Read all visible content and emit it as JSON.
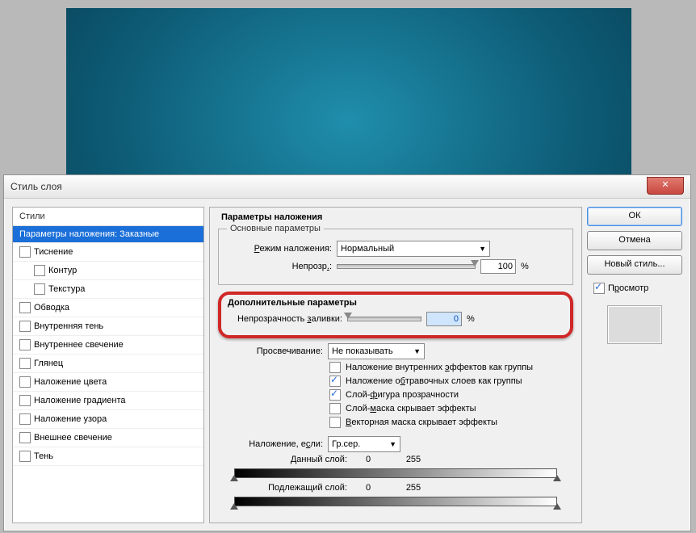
{
  "window_title": "Стиль слоя",
  "sidebar": {
    "header": "Стили",
    "items": [
      {
        "label": "Параметры наложения: Заказные",
        "selected": true,
        "checkbox": false,
        "indent": false
      },
      {
        "label": "Тиснение",
        "selected": false,
        "checkbox": true,
        "indent": false
      },
      {
        "label": "Контур",
        "selected": false,
        "checkbox": true,
        "indent": true
      },
      {
        "label": "Текстура",
        "selected": false,
        "checkbox": true,
        "indent": true
      },
      {
        "label": "Обводка",
        "selected": false,
        "checkbox": true,
        "indent": false
      },
      {
        "label": "Внутренняя тень",
        "selected": false,
        "checkbox": true,
        "indent": false
      },
      {
        "label": "Внутреннее свечение",
        "selected": false,
        "checkbox": true,
        "indent": false
      },
      {
        "label": "Глянец",
        "selected": false,
        "checkbox": true,
        "indent": false
      },
      {
        "label": "Наложение цвета",
        "selected": false,
        "checkbox": true,
        "indent": false
      },
      {
        "label": "Наложение градиента",
        "selected": false,
        "checkbox": true,
        "indent": false
      },
      {
        "label": "Наложение узора",
        "selected": false,
        "checkbox": true,
        "indent": false
      },
      {
        "label": "Внешнее свечение",
        "selected": false,
        "checkbox": true,
        "indent": false
      },
      {
        "label": "Тень",
        "selected": false,
        "checkbox": true,
        "indent": false
      }
    ]
  },
  "buttons": {
    "ok": "ОК",
    "cancel": "Отмена",
    "new_style": "Новый стиль...",
    "preview": "Просмотр"
  },
  "main": {
    "title": "Параметры наложения",
    "basic": {
      "legend": "Основные параметры",
      "blend_mode_label": "Режим наложения:",
      "blend_mode_value": "Нормальный",
      "opacity_label": "Непрозр.:",
      "opacity_value": "100",
      "percent": "%"
    },
    "adv": {
      "legend": "Дополнительные параметры",
      "fill_opacity_label": "Непрозрачность заливки:",
      "fill_opacity_value": "0",
      "percent": "%",
      "knockout_label": "Просвечивание:",
      "knockout_value": "Не показывать",
      "chk1": "Наложение внутренних эффектов как группы",
      "chk2": "Наложение обтравочных слоев как группы",
      "chk3": "Слой-фигура прозрачности",
      "chk4": "Слой-маска скрывает эффекты",
      "chk5": "Векторная маска скрывает эффекты"
    },
    "blendif": {
      "label": "Наложение, если:",
      "value": "Гр.сер.",
      "this_layer": "Данный слой:",
      "this_low": "0",
      "this_high": "255",
      "under_layer": "Подлежащий слой:",
      "under_low": "0",
      "under_high": "255"
    }
  }
}
